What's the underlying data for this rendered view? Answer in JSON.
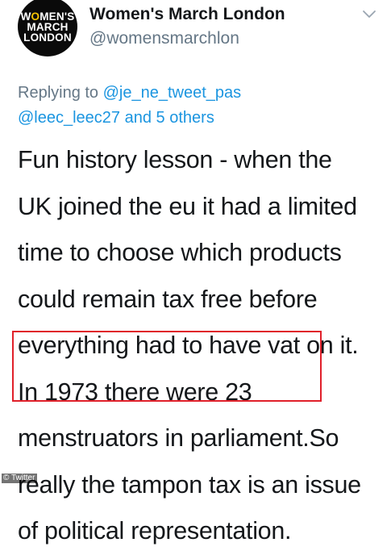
{
  "author": {
    "display_name": "Women's March London",
    "handle": "@womensmarchlon",
    "avatar_logo_text": [
      "WOMEN'S",
      "MARCH",
      "LONDON"
    ]
  },
  "reply": {
    "prefix": "Replying to ",
    "mention_1": "@je_ne_tweet_pas",
    "mention_2": "@leec_leec27",
    "joiner": " and ",
    "others": "5 others"
  },
  "body": {
    "lines": [
      "Fun history lesson - when the",
      "UK joined the eu it had a limited",
      "time to choose which products",
      "could remain tax free before",
      "everything had to have vat on it.",
      "In 1973 there were 23",
      "menstruators in parliament.",
      "So",
      "really the tampon tax is an issue",
      "of political representation."
    ]
  },
  "watermark": {
    "label": "© Twitter"
  },
  "icons": {
    "menu": "chevron-down-icon"
  },
  "colors": {
    "highlight_border": "#e0202a",
    "mention": "#1b95e0",
    "secondary_text": "#657786",
    "logo_accent": "#f4c300"
  }
}
